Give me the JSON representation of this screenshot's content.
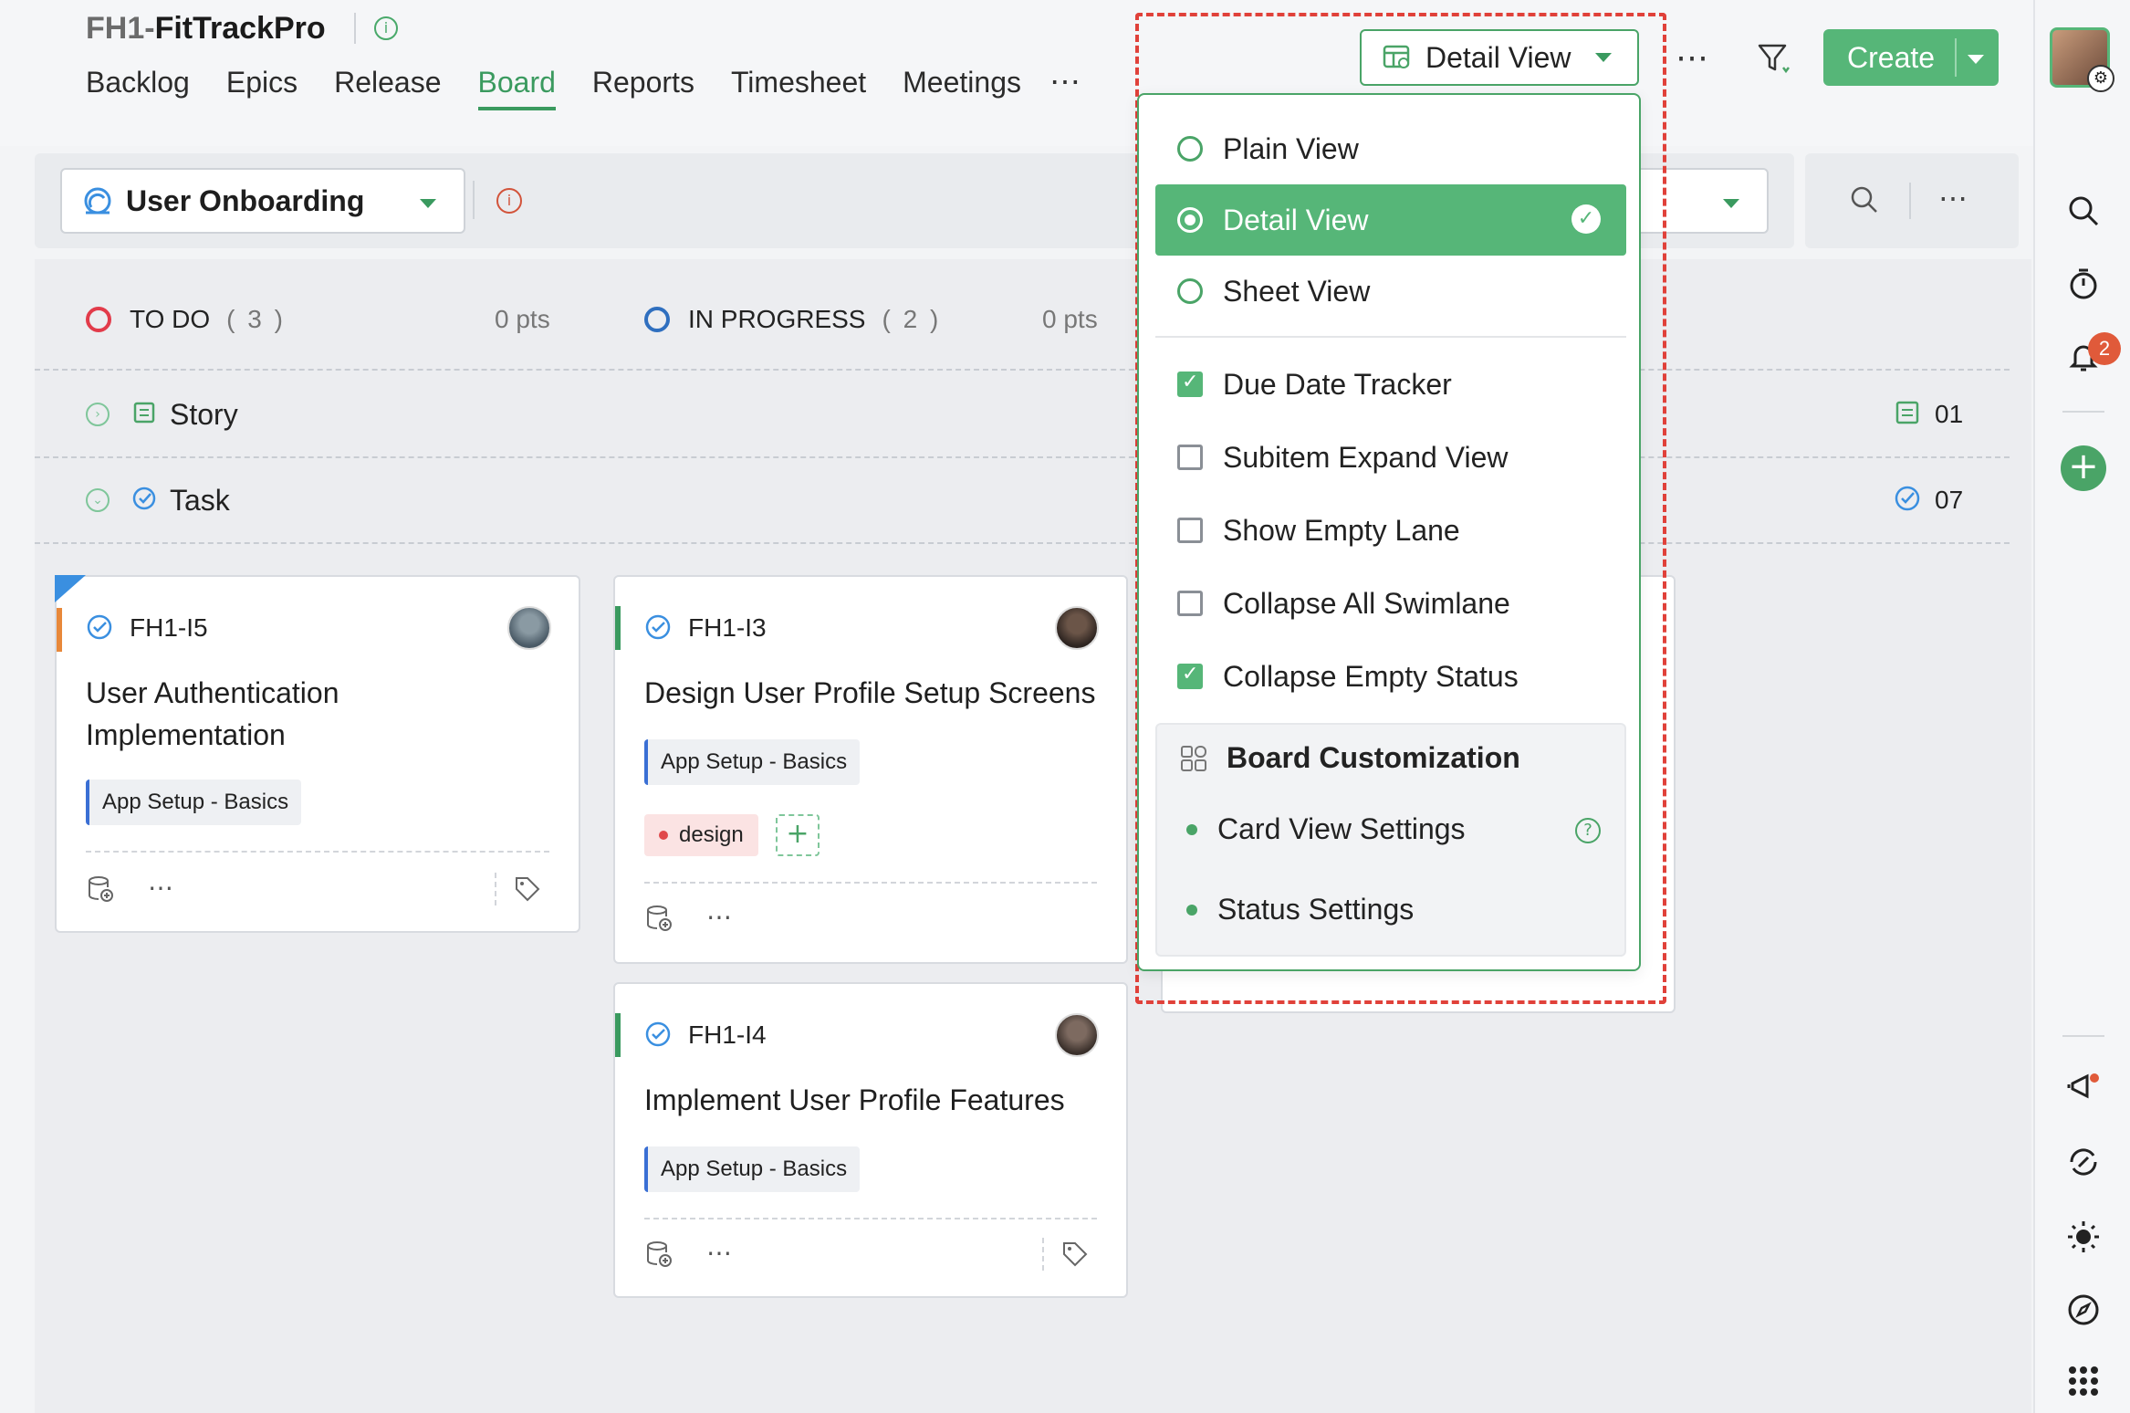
{
  "project": {
    "prefix": "FH1-",
    "name": "FitTrackPro"
  },
  "tabs": [
    "Backlog",
    "Epics",
    "Release",
    "Board",
    "Reports",
    "Timesheet",
    "Meetings"
  ],
  "active_tab": "Board",
  "toolbar": {
    "view_label": "Detail View",
    "create_label": "Create",
    "more": "⋯"
  },
  "sprint": {
    "label": "User Onboarding"
  },
  "statuses": [
    {
      "name": "TO DO",
      "count": "( 3 )",
      "pts": "0 pts",
      "color": "#e23b4a"
    },
    {
      "name": "IN PROGRESS",
      "count": "( 2 )",
      "pts": "0 pts",
      "color": "#2f6fbf"
    }
  ],
  "lanes": [
    {
      "name": "Story",
      "count": "01"
    },
    {
      "name": "Task",
      "count": "07"
    }
  ],
  "cards": [
    {
      "key": "FH1-I5",
      "title_line1": "User Authentication",
      "title_line2": "Implementation",
      "epic": "App Setup - Basics",
      "bar_color": "#e8883a"
    },
    {
      "key": "FH1-I3",
      "title": "Design User Profile Setup Screens",
      "epic": "App Setup - Basics",
      "tag": "design",
      "bar_color": "#3a9a5f"
    },
    {
      "key": "FH1-I4",
      "title": "Implement User Profile Features",
      "epic": "App Setup - Basics",
      "bar_color": "#3a9a5f"
    }
  ],
  "menu": {
    "views": [
      "Plain View",
      "Detail View",
      "Sheet View"
    ],
    "selected_view": "Detail View",
    "options": [
      {
        "label": "Due Date Tracker",
        "checked": true
      },
      {
        "label": "Subitem Expand View",
        "checked": false
      },
      {
        "label": "Show Empty Lane",
        "checked": false
      },
      {
        "label": "Collapse All Swimlane",
        "checked": false
      },
      {
        "label": "Collapse Empty Status",
        "checked": true
      }
    ],
    "customization": {
      "heading": "Board Customization",
      "items": [
        "Card View Settings",
        "Status Settings"
      ]
    }
  },
  "notifications": {
    "count": "2"
  },
  "colors": {
    "accent": "#56b678",
    "highlight": "#e0413a"
  }
}
